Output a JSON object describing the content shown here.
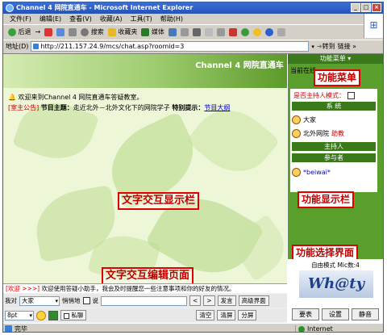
{
  "window": {
    "title": "Channel 4 网院直通车 - Microsoft Internet Explorer",
    "buttons": {
      "minimize": "_",
      "maximize": "□",
      "close": "×"
    }
  },
  "menu": [
    "文件(F)",
    "编辑(E)",
    "查看(V)",
    "收藏(A)",
    "工具(T)",
    "帮助(H)"
  ],
  "toolbar": {
    "back": "后退",
    "forward": "→",
    "search": "搜索",
    "favorites": "收藏夹",
    "media": "媒体"
  },
  "address": {
    "label": "地址(D)",
    "url": "http://211.157.24.9/mcs/chat.asp?roomid=3",
    "go": "转到",
    "links": "链接 »"
  },
  "chat": {
    "channel_title": "Channel 4 网院直通车",
    "welcome": "欢迎来到Channel 4 网院直通车答疑教室。",
    "notice_tag": "[室主公告]",
    "topic_label": "节目主题：",
    "topic_text": "走近北外－北外文化下的网院学子",
    "tip_label": "特别提示：",
    "tip_link": "节目大纲",
    "message_tag": "[欢迎 >>>]",
    "message_text": "欢迎使用答疑小助手，我会及时提醒您一些注意事项和你的好友的情况。"
  },
  "annotations": {
    "display": "文字交互显示栏",
    "editor": "文字交互编辑页面",
    "func_menu": "功能菜单",
    "func_display": "功能显示栏",
    "func_select": "功能选择界面"
  },
  "editor": {
    "to_label": "我对",
    "to_value": "大家",
    "whisper": "悄悄地",
    "say": "说",
    "prev": "<",
    "next": ">",
    "send": "发言",
    "advanced": "高级界面",
    "font_size": "8pt",
    "private_chat": "私聊",
    "clear": "清空",
    "clear_screen": "清屏",
    "split_screen": "分屏"
  },
  "sidebar": {
    "func_menu": "功能菜单",
    "online_prefix": "当前在线",
    "host_mode": "是否主持人模式：",
    "system": "系 统",
    "users": [
      {
        "name": "大家",
        "extra": ""
      },
      {
        "name": "北外网院",
        "extra": "助教"
      }
    ],
    "host": "主持人",
    "participants": "参与者",
    "participant": "*beiwai*",
    "mode": "自由模式 Mic数:4",
    "logo": "Wh@ty",
    "buttons": [
      "要表",
      "设置",
      "静音"
    ]
  },
  "status": {
    "text": "完毕",
    "zone": "Internet"
  }
}
